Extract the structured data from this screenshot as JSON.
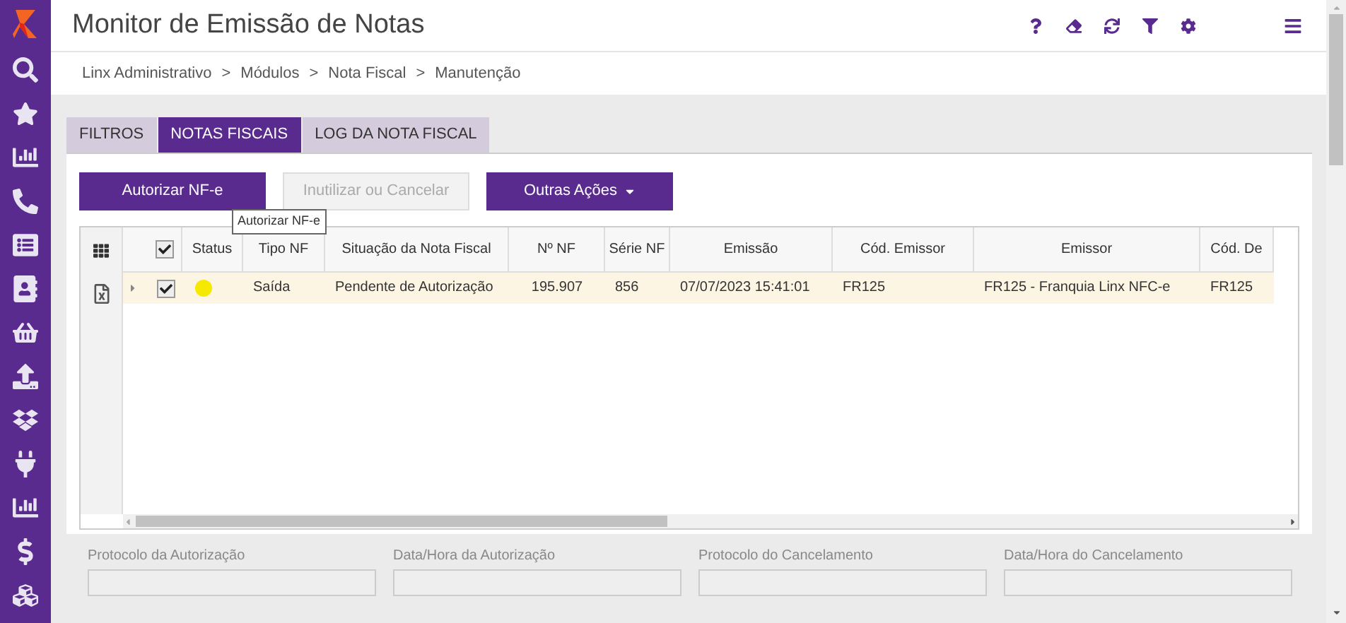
{
  "header": {
    "title": "Monitor de Emissão de Notas"
  },
  "breadcrumb": [
    "Linx Administrativo",
    "Módulos",
    "Nota Fiscal",
    "Manutenção"
  ],
  "breadcrumb_separator": ">",
  "tabs": [
    {
      "label": "FILTROS",
      "selected": false
    },
    {
      "label": "NOTAS FISCAIS",
      "selected": true
    },
    {
      "label": "LOG DA NOTA FISCAL",
      "selected": false
    }
  ],
  "actions": [
    {
      "label": "Autorizar NF-e",
      "disabled": false,
      "kind": "plain"
    },
    {
      "label": "Inutilizar ou Cancelar",
      "disabled": true,
      "kind": "plain"
    },
    {
      "label": "Outras Ações",
      "disabled": false,
      "kind": "dropdown"
    }
  ],
  "tooltip": "Autorizar NF-e",
  "table": {
    "all_checked": true,
    "columns": [
      "Status",
      "Tipo NF",
      "Situação da Nota Fiscal",
      "Nº NF",
      "Série NF",
      "Emissão",
      "Cód. Emissor",
      "Emissor",
      "Cód. De"
    ],
    "rows": [
      {
        "checked": true,
        "selected": true,
        "expanded": false,
        "color": "#f5e900",
        "cells": [
          "",
          "Saída",
          "Pendente de Autorização",
          "195.907",
          "856",
          "07/07/2023 15:41:01",
          "FR125",
          "FR125 - Franquia Linx NFC-e",
          "FR125"
        ]
      }
    ]
  },
  "fields": [
    {
      "label": "Protocolo da Autorização",
      "disabled": true
    },
    {
      "label": "Data/Hora da Autorização",
      "disabled": true
    },
    {
      "label": "Protocolo do Cancelamento",
      "disabled": true
    },
    {
      "label": "Data/Hora do Cancelamento",
      "disabled": true
    }
  ]
}
